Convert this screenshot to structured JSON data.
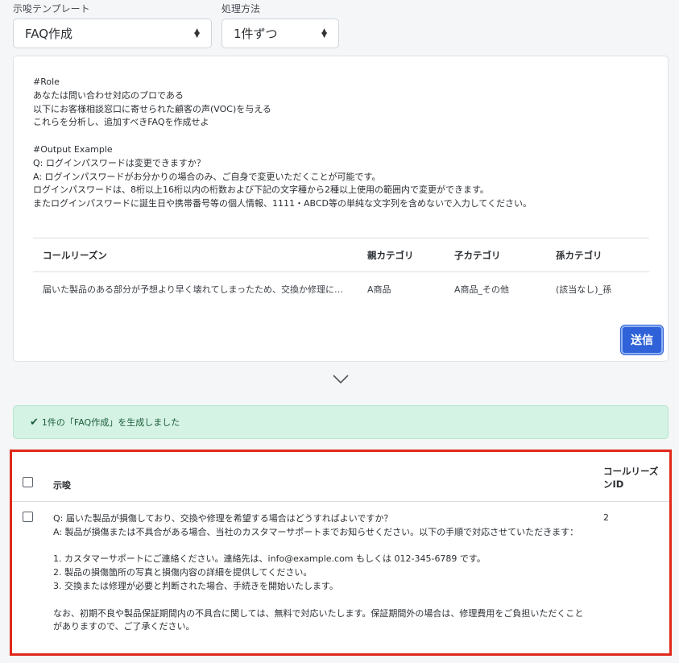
{
  "form": {
    "template_label": "示唆テンプレート",
    "template_value": "FAQ作成",
    "method_label": "処理方法",
    "method_value": "1件ずつ"
  },
  "prompt": {
    "text": "#Role\nあなたは問い合わせ対応のプロである\n以下にお客様相談窓口に寄せられた顧客の声(VOC)を与える\nこれらを分析し、追加すべきFAQを作成せよ\n\n#Output Example\nQ: ログインパスワードは変更できますか？\nA: ログインパスワードがお分かりの場合のみ、ご自身で変更いただくことが可能です。\nログインパスワードは、8桁以上16桁以内の桁数および下記の文字種から2種以上使用の範囲内で変更ができます。\nまたログインパスワードに誕生日や携帯番号等の個人情報、1111・ABCD等の単純な文字列を含めないで入力してください。"
  },
  "input_table": {
    "headers": [
      "コールリーズン",
      "親カテゴリ",
      "子カテゴリ",
      "孫カテゴリ"
    ],
    "row": [
      "届いた製品のある部分が予想より早く壊れてしまったため、交換か修理に…",
      "A商品",
      "A商品_その他",
      "(該当なし)_孫"
    ]
  },
  "send_label": "送信",
  "alert": {
    "check": "✔",
    "message": "1件の「FAQ作成」を生成しました"
  },
  "result": {
    "header_suggest": "示唆",
    "header_id": "コールリーズンID",
    "row_text": "Q: 届いた製品が損傷しており、交換や修理を希望する場合はどうすればよいですか？\nA: 製品が損傷または不具合がある場合、当社のカスタマーサポートまでお知らせください。以下の手順で対応させていただきます：\n\n1. カスタマーサポートにご連絡ください。連絡先は、info@example.com もしくは 012-345-6789 です。\n2. 製品の損傷箇所の写真と損傷内容の詳細を提供してください。\n3. 交換または修理が必要と判断された場合、手続きを開始いたします。\n\nなお、初期不良や製品保証期間内の不具合に関しては、無料で対応いたします。保証期間外の場合は、修理費用をご負担いただくことがありますので、ご了承ください。",
    "row_id": "2"
  }
}
